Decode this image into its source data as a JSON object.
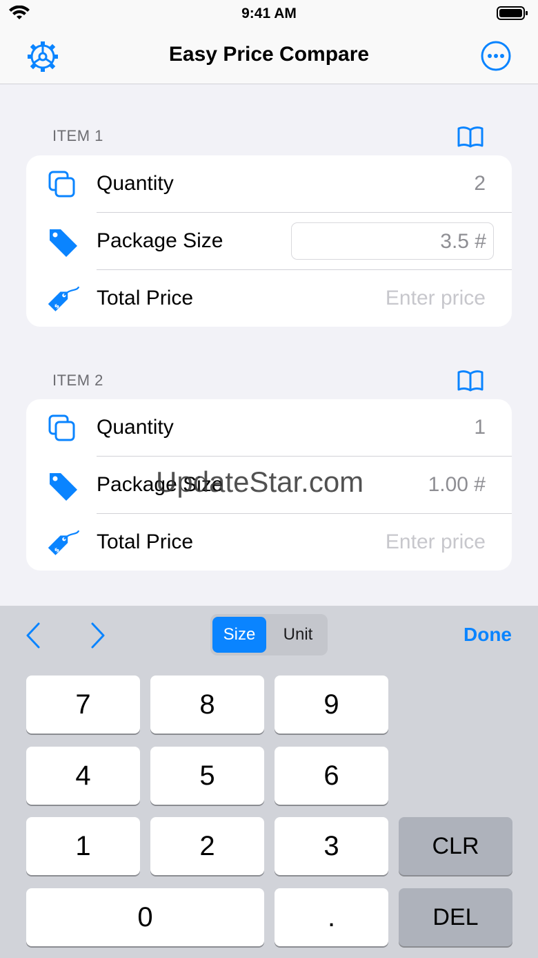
{
  "status_bar": {
    "time": "9:41 AM"
  },
  "nav": {
    "title": "Easy Price Compare"
  },
  "items": [
    {
      "header": "ITEM 1",
      "rows": [
        {
          "label": "Quantity",
          "value": "2"
        },
        {
          "label": "Package Size",
          "value": "3.5 #"
        },
        {
          "label": "Total Price",
          "placeholder": "Enter price"
        }
      ]
    },
    {
      "header": "ITEM 2",
      "rows": [
        {
          "label": "Quantity",
          "value": "1"
        },
        {
          "label": "Package Size",
          "value": "1.00 #"
        },
        {
          "label": "Total Price",
          "placeholder": "Enter price"
        }
      ]
    }
  ],
  "watermark": "UpdateStar.com",
  "keyboard": {
    "segments": [
      "Size",
      "Unit"
    ],
    "selected_segment": "Size",
    "done_label": "Done",
    "keys": [
      "7",
      "8",
      "9",
      "4",
      "5",
      "6",
      "1",
      "2",
      "3",
      "CLR",
      "0",
      ".",
      "DEL"
    ]
  },
  "colors": {
    "accent": "#0a84ff",
    "background": "#f2f2f7",
    "keyboard": "#d1d3d9"
  },
  "icons": [
    "wifi-icon",
    "battery-icon",
    "gear-icon",
    "ellipsis-circle-icon",
    "book-icon",
    "copy-icon",
    "tag-icon",
    "price-tag-icon",
    "chevron-left-icon",
    "chevron-right-icon"
  ]
}
